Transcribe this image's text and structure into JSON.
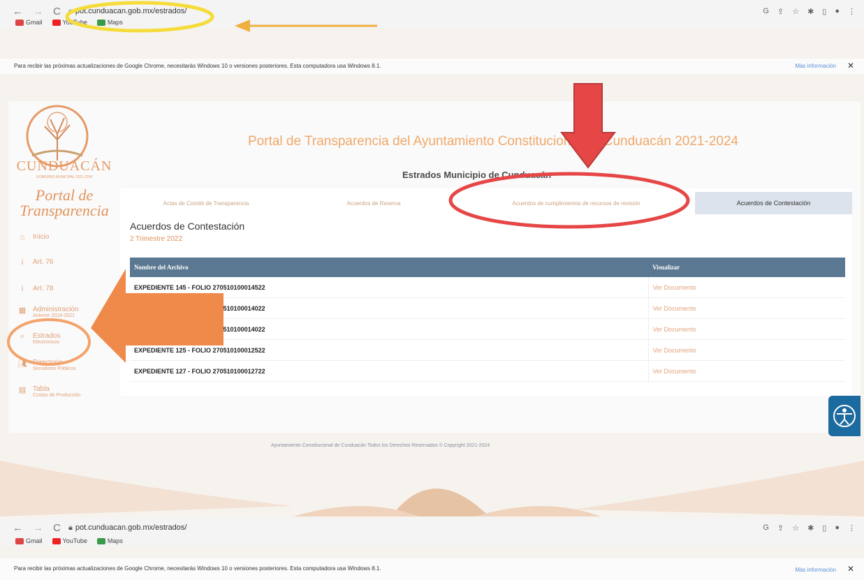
{
  "browser": {
    "url": "pot.cunduacan.gob.mx/estrados/",
    "bookmarks": [
      "Gmail",
      "YouTube",
      "Maps"
    ],
    "infobar_text": "Para recibir las próximas actualizaciones de Google Chrome, necesitarás Windows 10 o versiones posteriores. Esta computadora usa Windows 8.1.",
    "infobar_link": "Más información",
    "colors": {
      "toolbar": "#f4f4f4",
      "infobar_link": "#5a8fd8"
    }
  },
  "sidebar": {
    "logo_name": "CUNDUACÁN",
    "logo_tagline": "GOBIERNO MUNICIPAL 2021-2024",
    "portal_title_1": "Portal de",
    "portal_title_2": "Transparencia",
    "items": [
      {
        "icon": "home-icon",
        "label": "Inicio",
        "sub": ""
      },
      {
        "icon": "info-icon",
        "label": "Art. 76",
        "sub": ""
      },
      {
        "icon": "info-icon",
        "label": "Art. 78",
        "sub": ""
      },
      {
        "icon": "calendar-icon",
        "label": "Administración",
        "sub": "Anterior 2018-2021"
      },
      {
        "icon": "search-icon",
        "label": "Estrados",
        "sub": "Electrónicos"
      },
      {
        "icon": "users-icon",
        "label": "Directorio",
        "sub": "Servidores Públicos"
      },
      {
        "icon": "table-icon",
        "label": "Tabla",
        "sub": "Costos de Producción"
      }
    ]
  },
  "header": {
    "title": "Portal de Transparencia del Ayuntamiento Constitucional de Cunduacán  2021-2024",
    "subtitle": "Estrados Municipio de Cunduacán"
  },
  "tabs": [
    {
      "label": "Actas de Comité de Transparencia",
      "active": false
    },
    {
      "label": "Acuerdos de Reserva",
      "active": false
    },
    {
      "label": "Acuerdos de cumplimientos de recursos de revisión",
      "active": false
    },
    {
      "label": "Acuerdos de Contestación",
      "active": true
    }
  ],
  "section": {
    "title": "Acuerdos de Contestación",
    "period": "2 Trimestre 2022"
  },
  "table": {
    "headers": [
      "Nombre del Archivo",
      "Visualizar"
    ],
    "rows": [
      {
        "name": "EXPEDIENTE 145 - FOLIO 270510100014522",
        "link": "Ver Documento"
      },
      {
        "name": "EXPEDIENTE 140 - FOLIO 270510100014022",
        "link": "Ver Documento"
      },
      {
        "name": "EXPEDIENTE 140 - FOLIO 270510100014022",
        "link": "Ver Documento"
      },
      {
        "name": "EXPEDIENTE 125 - FOLIO 270510100012522",
        "link": "Ver Documento"
      },
      {
        "name": "EXPEDIENTE 127 - FOLIO 270510100012722",
        "link": "Ver Documento"
      }
    ]
  },
  "footer": {
    "text": "Ayuntamiento Constitucional de Cunduacán Todos los Derechos Reservados © Copyright 2021-2024"
  },
  "annotations": {
    "colors": {
      "yellow": "#f5dc3c",
      "red": "#e64646",
      "orange": "#f08a4b",
      "footer_brown": "#e7c3a6"
    }
  }
}
